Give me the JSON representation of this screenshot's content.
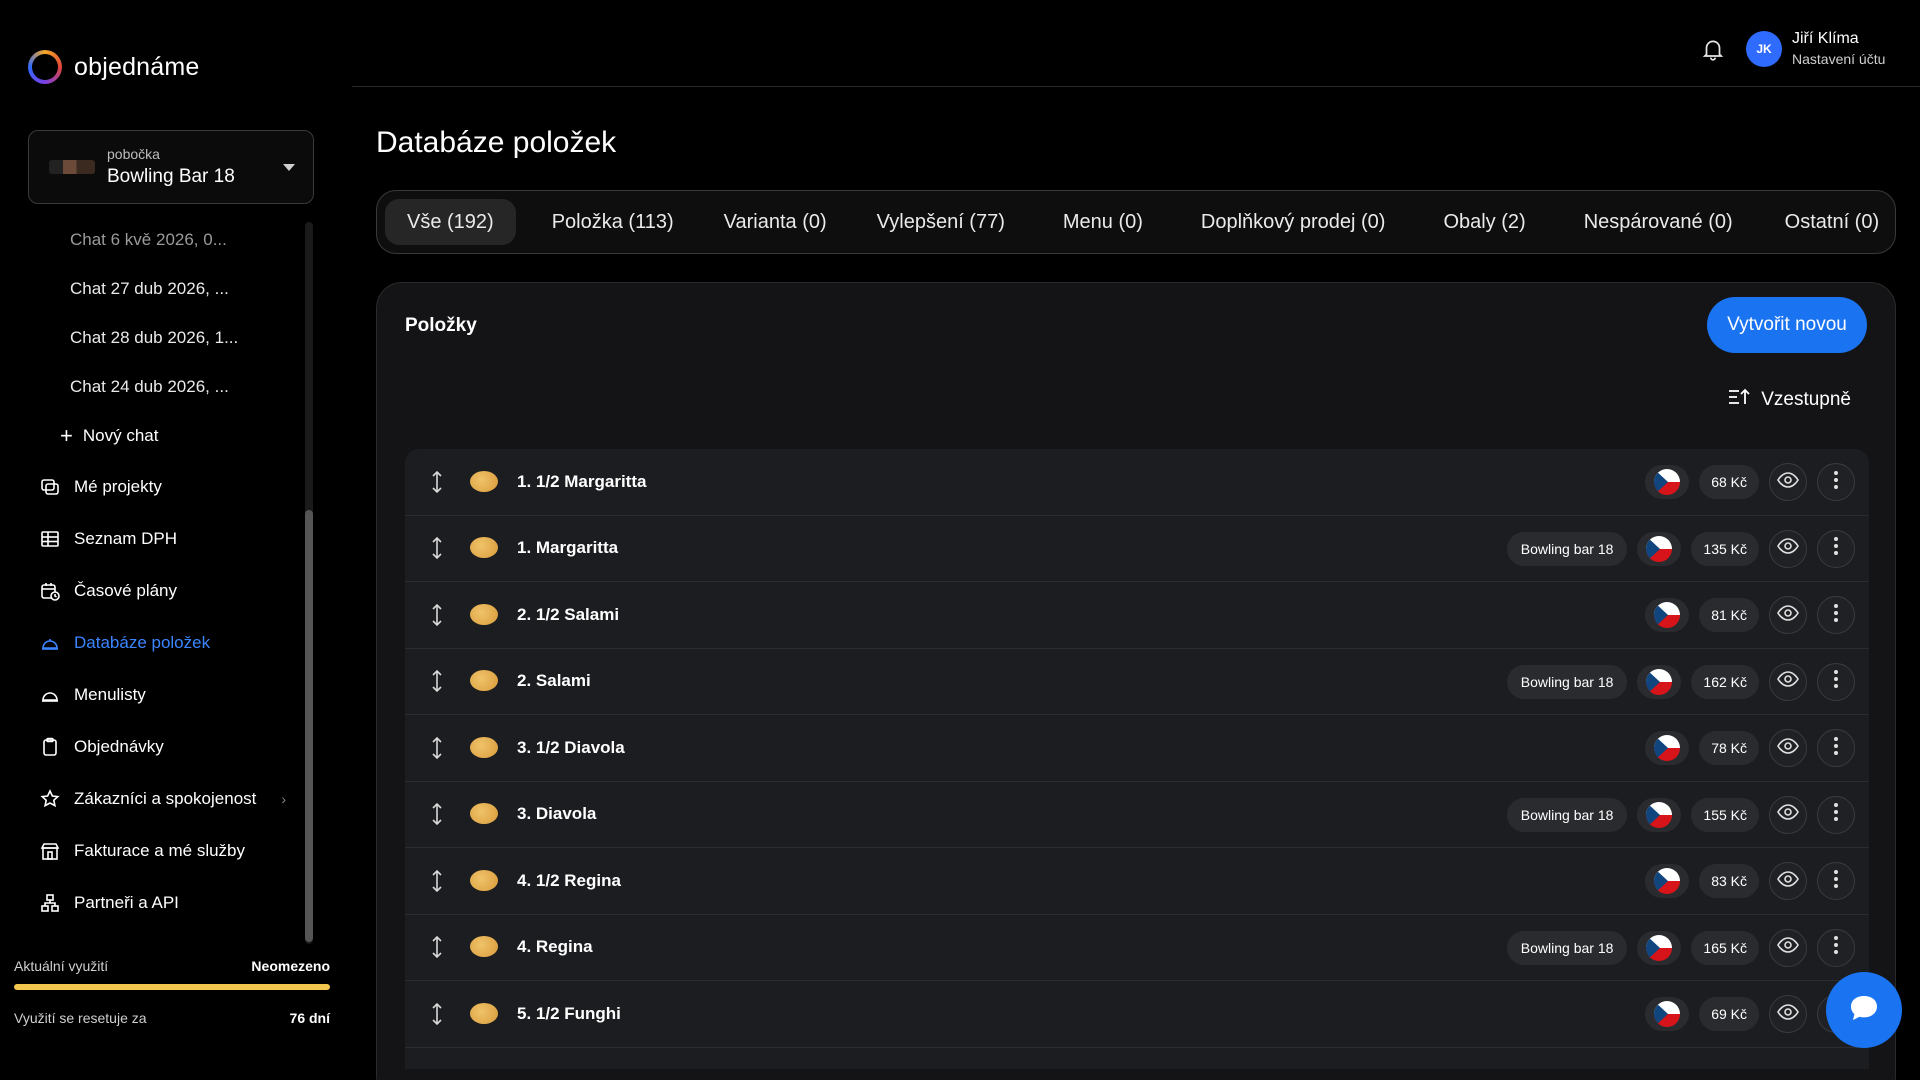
{
  "app": {
    "logo_text": "objednáme"
  },
  "branch": {
    "label": "pobočka",
    "name": "Bowling Bar 18"
  },
  "sidebar": {
    "chats": [
      "Chat 6 kvě 2026, 0...",
      "Chat 27 dub 2026, ...",
      "Chat 28 dub 2026, 1...",
      "Chat 24 dub 2026, ..."
    ],
    "new_chat": "Nový chat",
    "items": [
      {
        "label": "Mé projekty",
        "icon": "projects-icon"
      },
      {
        "label": "Seznam DPH",
        "icon": "table-icon"
      },
      {
        "label": "Časové plány",
        "icon": "calendar-clock-icon"
      },
      {
        "label": "Databáze položek",
        "icon": "database-icon"
      },
      {
        "label": "Menulisty",
        "icon": "menu-cloche-icon"
      },
      {
        "label": "Objednávky",
        "icon": "clipboard-icon"
      },
      {
        "label": "Zákazníci a spokojenost",
        "icon": "star-icon"
      },
      {
        "label": "Fakturace a mé služby",
        "icon": "store-icon"
      },
      {
        "label": "Partneři a API",
        "icon": "network-icon"
      }
    ]
  },
  "usage": {
    "label": "Aktuální využití",
    "value": "Neomezeno",
    "level": 1.0,
    "reset_label": "Využití se resetuje za",
    "reset_value": "76 dní",
    "bar_color": "#f3c64e"
  },
  "user": {
    "initials": "JK",
    "name": "Jiří Klíma",
    "subtitle": "Nastavení účtu"
  },
  "page": {
    "title": "Databáze položek"
  },
  "tabs": [
    "Vše (192)",
    "Položka (113)",
    "Varianta (0)",
    "Vylepšení (77)",
    "Menu (0)",
    "Doplňkový prodej (0)",
    "Obaly (2)",
    "Nespárované (0)",
    "Ostatní (0)"
  ],
  "card": {
    "title": "Položky",
    "create_label": "Vytvořit novou",
    "sort_label": "Vzestupně"
  },
  "rows": [
    {
      "name": "1. 1/2 Margaritta",
      "branch": "",
      "price": "68 Kč"
    },
    {
      "name": "1. Margaritta",
      "branch": "Bowling bar 18",
      "price": "135 Kč"
    },
    {
      "name": "2. 1/2 Salami",
      "branch": "",
      "price": "81 Kč"
    },
    {
      "name": "2. Salami",
      "branch": "Bowling bar 18",
      "price": "162 Kč"
    },
    {
      "name": "3. 1/2 Diavola",
      "branch": "",
      "price": "78 Kč"
    },
    {
      "name": "3. Diavola",
      "branch": "Bowling bar 18",
      "price": "155 Kč"
    },
    {
      "name": "4. 1/2 Regina",
      "branch": "",
      "price": "83 Kč"
    },
    {
      "name": "4. Regina",
      "branch": "Bowling bar 18",
      "price": "165 Kč"
    },
    {
      "name": "5. 1/2 Funghi",
      "branch": "",
      "price": "69 Kč"
    }
  ],
  "colors": {
    "accent": "#1a73f0",
    "active_nav": "#3b86ff"
  }
}
